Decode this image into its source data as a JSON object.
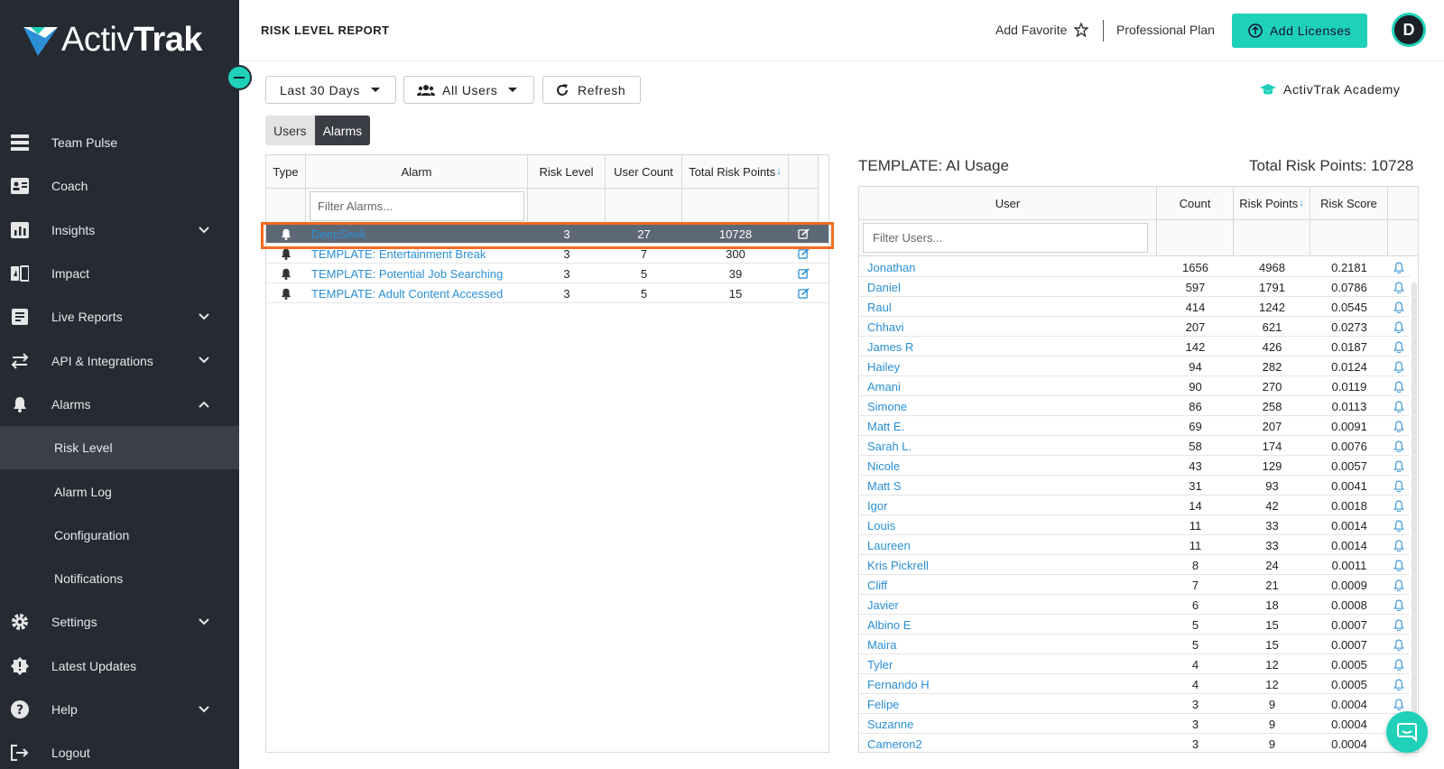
{
  "brand": {
    "logo_text_light": "Activ",
    "logo_text_bold": "Trak",
    "accent": "#1fd1b9",
    "sidebar_bg": "#252a33"
  },
  "sidebar": {
    "items": [
      {
        "label": "Team Pulse",
        "icon": "team-pulse-icon"
      },
      {
        "label": "Coach",
        "icon": "coach-icon"
      },
      {
        "label": "Insights",
        "icon": "insights-icon",
        "expandable": true
      },
      {
        "label": "Impact",
        "icon": "impact-icon"
      },
      {
        "label": "Live Reports",
        "icon": "live-reports-icon",
        "expandable": true
      },
      {
        "label": "API & Integrations",
        "icon": "integrations-icon",
        "expandable": true
      },
      {
        "label": "Alarms",
        "icon": "bell-icon",
        "expanded": true
      }
    ],
    "alarm_subitems": [
      "Risk Level",
      "Alarm Log",
      "Configuration",
      "Notifications"
    ],
    "bottom_items": [
      {
        "label": "Settings",
        "icon": "gear-icon",
        "expandable": true
      },
      {
        "label": "Latest Updates",
        "icon": "updates-icon"
      },
      {
        "label": "Help",
        "icon": "help-icon",
        "expandable": true
      },
      {
        "label": "Logout",
        "icon": "logout-icon"
      }
    ]
  },
  "header": {
    "title": "RISK LEVEL REPORT",
    "add_favorite": "Add Favorite",
    "plan": "Professional Plan",
    "add_licenses": "Add Licenses",
    "avatar_initial": "D"
  },
  "toolbar": {
    "date_range": "Last 30 Days",
    "users": "All Users",
    "refresh": "Refresh",
    "academy": "ActivTrak Academy"
  },
  "view_toggle": {
    "users": "Users",
    "alarms": "Alarms",
    "selected": "Alarms"
  },
  "alarms_table": {
    "headers": {
      "type": "Type",
      "alarm": "Alarm",
      "risk_level": "Risk Level",
      "user_count": "User Count",
      "total_risk_points": "Total Risk Points"
    },
    "filter_placeholder": "Filter Alarms...",
    "rows": [
      {
        "alarm": "DeepSeek",
        "risk_level": "3",
        "user_count": "27",
        "total_risk_points": "10728",
        "selected": true
      },
      {
        "alarm": "TEMPLATE: Entertainment Break",
        "risk_level": "3",
        "user_count": "7",
        "total_risk_points": "300"
      },
      {
        "alarm": "TEMPLATE: Potential Job Searching",
        "risk_level": "3",
        "user_count": "5",
        "total_risk_points": "39"
      },
      {
        "alarm": "TEMPLATE: Adult Content Accessed",
        "risk_level": "3",
        "user_count": "5",
        "total_risk_points": "15"
      }
    ]
  },
  "detail": {
    "title": "TEMPLATE: AI Usage",
    "total_risk_points": "Total Risk Points: 10728",
    "headers": {
      "user": "User",
      "count": "Count",
      "risk_points": "Risk Points",
      "risk_score": "Risk Score"
    },
    "filter_placeholder": "Filter Users...",
    "rows": [
      {
        "user": "Jonathan",
        "count": "1656",
        "points": "4968",
        "score": "0.2181"
      },
      {
        "user": "Daniel",
        "count": "597",
        "points": "1791",
        "score": "0.0786"
      },
      {
        "user": "Raul",
        "count": "414",
        "points": "1242",
        "score": "0.0545"
      },
      {
        "user": "Chhavi",
        "count": "207",
        "points": "621",
        "score": "0.0273"
      },
      {
        "user": "James R",
        "count": "142",
        "points": "426",
        "score": "0.0187"
      },
      {
        "user": "Hailey",
        "count": "94",
        "points": "282",
        "score": "0.0124"
      },
      {
        "user": "Amani",
        "count": "90",
        "points": "270",
        "score": "0.0119"
      },
      {
        "user": "Simone",
        "count": "86",
        "points": "258",
        "score": "0.0113"
      },
      {
        "user": "Matt E.",
        "count": "69",
        "points": "207",
        "score": "0.0091"
      },
      {
        "user": "Sarah L.",
        "count": "58",
        "points": "174",
        "score": "0.0076"
      },
      {
        "user": "Nicole",
        "count": "43",
        "points": "129",
        "score": "0.0057"
      },
      {
        "user": "Matt S",
        "count": "31",
        "points": "93",
        "score": "0.0041"
      },
      {
        "user": "Igor",
        "count": "14",
        "points": "42",
        "score": "0.0018"
      },
      {
        "user": "Louis",
        "count": "11",
        "points": "33",
        "score": "0.0014"
      },
      {
        "user": "Laureen",
        "count": "11",
        "points": "33",
        "score": "0.0014"
      },
      {
        "user": "Kris Pickrell",
        "count": "8",
        "points": "24",
        "score": "0.0011"
      },
      {
        "user": "Cliff",
        "count": "7",
        "points": "21",
        "score": "0.0009"
      },
      {
        "user": "Javier",
        "count": "6",
        "points": "18",
        "score": "0.0008"
      },
      {
        "user": "Albino E",
        "count": "5",
        "points": "15",
        "score": "0.0007"
      },
      {
        "user": "Maira",
        "count": "5",
        "points": "15",
        "score": "0.0007"
      },
      {
        "user": "Tyler",
        "count": "4",
        "points": "12",
        "score": "0.0005"
      },
      {
        "user": "Fernando H",
        "count": "4",
        "points": "12",
        "score": "0.0005"
      },
      {
        "user": "Felipe",
        "count": "3",
        "points": "9",
        "score": "0.0004"
      },
      {
        "user": "Suzanne",
        "count": "3",
        "points": "9",
        "score": "0.0004"
      },
      {
        "user": "Cameron2",
        "count": "3",
        "points": "9",
        "score": "0.0004"
      }
    ]
  }
}
